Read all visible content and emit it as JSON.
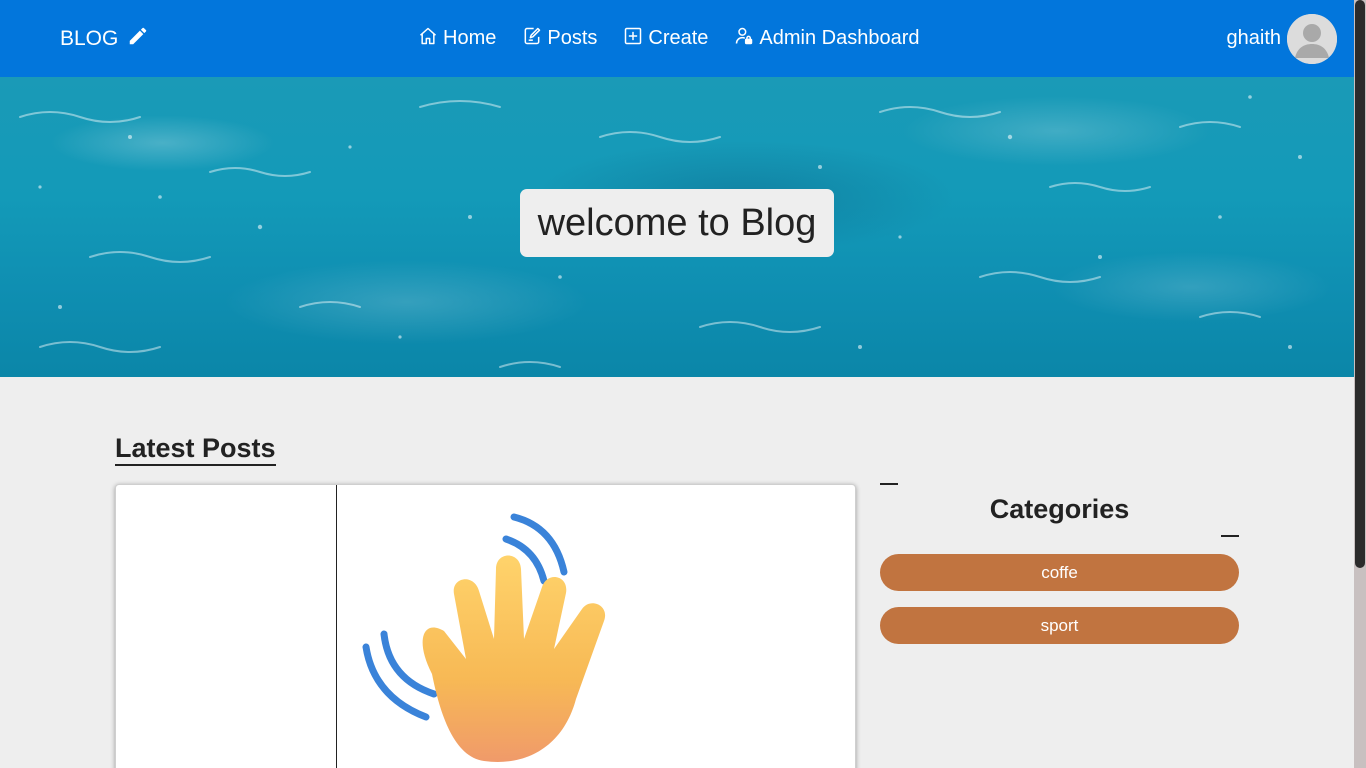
{
  "navbar": {
    "brand": "BLOG",
    "brand_icon": "pencil-icon",
    "links": [
      {
        "label": "Home",
        "icon": "home-icon"
      },
      {
        "label": "Posts",
        "icon": "edit-document-icon"
      },
      {
        "label": "Create",
        "icon": "plus-square-icon"
      },
      {
        "label": "Admin Dashboard",
        "icon": "user-lock-icon"
      }
    ],
    "username": "ghaith",
    "colors": {
      "background": "#0276dc",
      "text": "#ffffff"
    }
  },
  "hero": {
    "title": "welcome to Blog"
  },
  "main": {
    "section_title": "Latest Posts",
    "post_image_icon": "waving-hand-icon"
  },
  "sidebar": {
    "title": "Categories",
    "categories": [
      {
        "label": "coffe"
      },
      {
        "label": "sport"
      }
    ],
    "colors": {
      "category_button": "#c17440"
    }
  }
}
